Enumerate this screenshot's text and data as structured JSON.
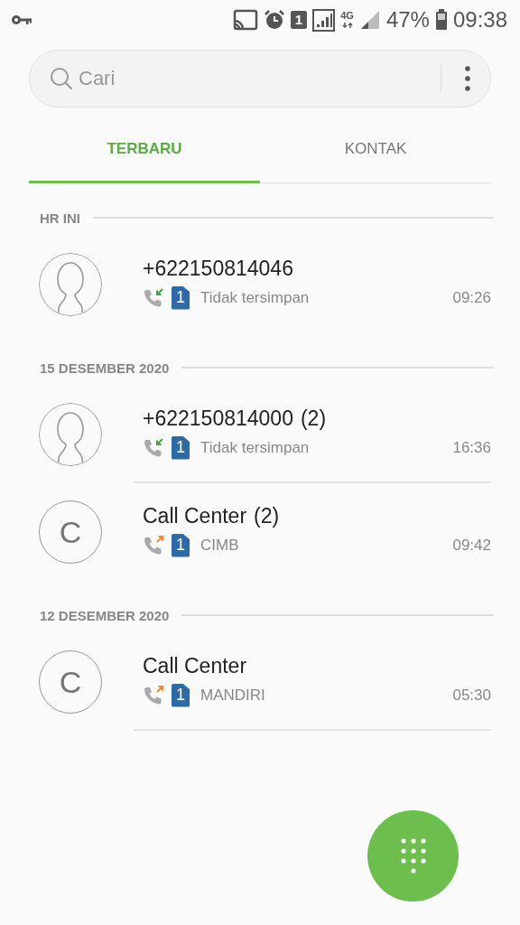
{
  "status_bar": {
    "sim": "1",
    "network": "4G",
    "battery": "47%",
    "time": "09:38"
  },
  "search": {
    "placeholder": "Cari"
  },
  "tabs": [
    {
      "label": "TERBARU",
      "selected": true
    },
    {
      "label": "KONTAK",
      "selected": false
    }
  ],
  "groups": [
    {
      "header": "HR INI",
      "calls": [
        {
          "kind": "person",
          "name": "+622150814046",
          "outgoing": false,
          "sim": "1",
          "detail": "Tidak tersimpan",
          "time": "09:26"
        }
      ]
    },
    {
      "header": "15 DESEMBER 2020",
      "calls": [
        {
          "kind": "person",
          "name": "+622150814000",
          "count": "(2)",
          "outgoing": false,
          "sim": "1",
          "detail": "Tidak tersimpan",
          "time": "16:36"
        },
        {
          "kind": "letter",
          "initial": "C",
          "name": "Call Center",
          "count": "(2)",
          "outgoing": true,
          "sim": "1",
          "detail": "CIMB",
          "time": "09:42"
        }
      ]
    },
    {
      "header": "12 DESEMBER 2020",
      "calls": [
        {
          "kind": "letter",
          "initial": "C",
          "name": "Call Center",
          "outgoing": true,
          "sim": "1",
          "detail": "MANDIRI",
          "time": "05:30"
        }
      ]
    }
  ]
}
